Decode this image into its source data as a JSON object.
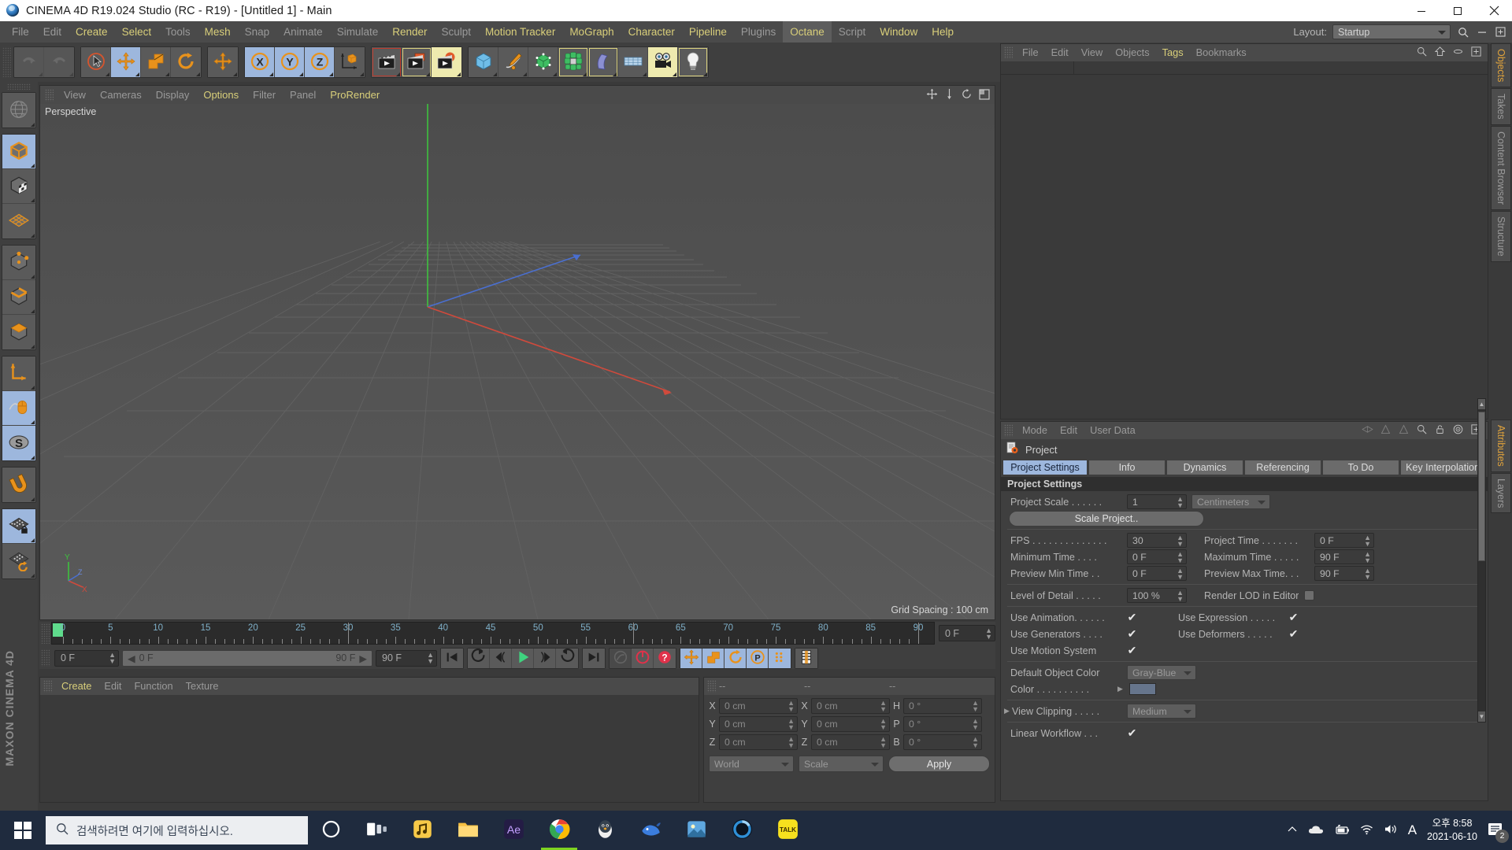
{
  "window": {
    "title": "CINEMA 4D R19.024 Studio (RC - R19) - [Untitled 1] - Main",
    "icon": "c4d-logo-icon",
    "minimize": "─",
    "maximize": "☐",
    "close": "✕"
  },
  "menubar": {
    "items": [
      {
        "label": "File",
        "state": "dim"
      },
      {
        "label": "Edit",
        "state": "dim"
      },
      {
        "label": "Create",
        "state": "hl"
      },
      {
        "label": "Select",
        "state": "hl"
      },
      {
        "label": "Tools",
        "state": "dim"
      },
      {
        "label": "Mesh",
        "state": "hl"
      },
      {
        "label": "Snap",
        "state": "dim"
      },
      {
        "label": "Animate",
        "state": "dim"
      },
      {
        "label": "Simulate",
        "state": "dim"
      },
      {
        "label": "Render",
        "state": "hl"
      },
      {
        "label": "Sculpt",
        "state": "dim"
      },
      {
        "label": "Motion Tracker",
        "state": "hl"
      },
      {
        "label": "MoGraph",
        "state": "hl"
      },
      {
        "label": "Character",
        "state": "hl"
      },
      {
        "label": "Pipeline",
        "state": "hl"
      },
      {
        "label": "Plugins",
        "state": "dim"
      },
      {
        "label": "Octane",
        "state": "boxed"
      },
      {
        "label": "Script",
        "state": "dim"
      },
      {
        "label": "Window",
        "state": "hl"
      },
      {
        "label": "Help",
        "state": "hl"
      }
    ],
    "layout_label": "Layout:",
    "layout_value": "Startup",
    "search_icon": "search-icon",
    "minus_icon": "minus-icon",
    "expand_icon": "expand-icon"
  },
  "toolbar": {
    "groups": [
      {
        "name": "history",
        "buttons": [
          {
            "name": "undo-button",
            "icon": "undo-icon",
            "state": "disabled"
          },
          {
            "name": "redo-button",
            "icon": "redo-icon",
            "state": "disabled"
          }
        ]
      },
      {
        "name": "tools",
        "buttons": [
          {
            "name": "live-selection-button",
            "icon": "cursor-select-icon",
            "state": "normal"
          },
          {
            "name": "move-button",
            "icon": "move-icon",
            "state": "selected"
          },
          {
            "name": "scale-button",
            "icon": "scale-icon",
            "state": "normal"
          },
          {
            "name": "rotate-button",
            "icon": "rotate-icon",
            "state": "normal"
          }
        ]
      },
      {
        "name": "move-alt",
        "buttons": [
          {
            "name": "move-alt-button",
            "icon": "move-icon",
            "state": "normal"
          }
        ]
      },
      {
        "name": "axis-lock",
        "buttons": [
          {
            "name": "axis-x-button",
            "icon": "axis-x-icon",
            "state": "selected"
          },
          {
            "name": "axis-y-button",
            "icon": "axis-y-icon",
            "state": "selected"
          },
          {
            "name": "axis-z-button",
            "icon": "axis-z-icon",
            "state": "selected"
          },
          {
            "name": "world-object-coord-button",
            "icon": "world-coord-icon",
            "state": "normal"
          }
        ]
      },
      {
        "name": "render",
        "buttons": [
          {
            "name": "render-view-button",
            "icon": "clapper-icon",
            "state": "redbox"
          },
          {
            "name": "render-to-picture-viewer-button",
            "icon": "clapper-picture-icon",
            "state": "yellowbox"
          },
          {
            "name": "render-settings-button",
            "icon": "clapper-gear-icon",
            "state": "selected2"
          }
        ]
      },
      {
        "name": "objects",
        "buttons": [
          {
            "name": "add-cube-button",
            "icon": "cube-icon",
            "state": "normal"
          },
          {
            "name": "add-spline-button",
            "icon": "pen-spline-icon",
            "state": "normal"
          },
          {
            "name": "add-generator-button",
            "icon": "green-cube-icon",
            "state": "normal"
          },
          {
            "name": "add-mograph-button",
            "icon": "cloner-icon",
            "state": "yellowbox"
          },
          {
            "name": "add-deformer-button",
            "icon": "bend-deformer-icon",
            "state": "yellowbox"
          },
          {
            "name": "add-environment-button",
            "icon": "floor-icon",
            "state": "normal"
          },
          {
            "name": "add-camera-button",
            "icon": "camera-icon",
            "state": "selected2"
          },
          {
            "name": "add-light-button",
            "icon": "light-bulb-icon",
            "state": "yellowbox"
          }
        ]
      }
    ]
  },
  "left_toolbar": {
    "buttons": [
      {
        "name": "make-editable-button",
        "icon": "globe-wire-icon",
        "state": "normal"
      },
      {
        "name": "model-mode-button",
        "icon": "model-cube-icon",
        "state": "selected"
      },
      {
        "name": "texture-mode-button",
        "icon": "texture-cube-icon",
        "state": "normal"
      },
      {
        "name": "workplane-mode-button",
        "icon": "workplane-grid-icon",
        "state": "normal"
      },
      {
        "name": "points-mode-button",
        "icon": "points-cube-icon",
        "state": "normal"
      },
      {
        "name": "edges-mode-button",
        "icon": "edges-cube-icon",
        "state": "normal"
      },
      {
        "name": "polygons-mode-button",
        "icon": "polygons-cube-icon",
        "state": "normal"
      },
      {
        "name": "object-axis-button",
        "icon": "axis-L-icon",
        "state": "normal"
      },
      {
        "name": "enable-snap-button",
        "icon": "mouse-snap-icon",
        "state": "selected"
      },
      {
        "name": "soft-selection-button",
        "icon": "s-oval-icon",
        "state": "selected"
      },
      {
        "name": "magnet-button",
        "icon": "magnet-icon",
        "state": "normal"
      },
      {
        "name": "lock-workplane-button",
        "icon": "grid-lock-icon",
        "state": "selected"
      },
      {
        "name": "planar-workplane-button",
        "icon": "grid-rotate-icon",
        "state": "normal"
      }
    ],
    "brand_line1": "MAXON",
    "brand_line2": "CINEMA 4D"
  },
  "viewport": {
    "menu": [
      {
        "label": "View",
        "state": "dim"
      },
      {
        "label": "Cameras",
        "state": "dim"
      },
      {
        "label": "Display",
        "state": "dim"
      },
      {
        "label": "Options",
        "state": "hl"
      },
      {
        "label": "Filter",
        "state": "dim"
      },
      {
        "label": "Panel",
        "state": "dim"
      },
      {
        "label": "ProRender",
        "state": "hl"
      }
    ],
    "perspective_label": "Perspective",
    "grid_spacing": "Grid Spacing : 100 cm",
    "axis_labels": {
      "y": "Y",
      "x": "X",
      "z": "Z"
    },
    "nav_icons": [
      "pan-icon",
      "dolly-icon",
      "rotate-view-icon",
      "maximize-view-icon"
    ]
  },
  "timeline": {
    "ticks": [
      0,
      5,
      10,
      15,
      20,
      25,
      30,
      35,
      40,
      45,
      50,
      55,
      60,
      65,
      70,
      75,
      80,
      85,
      90
    ],
    "current_frame_field": "0 F",
    "range_start": "0 F",
    "range_end": "90 F",
    "max_frame_field": "90 F",
    "right_frame_field": "0 F",
    "transport": [
      {
        "name": "go-to-start-button",
        "icon": "skip-start-icon"
      },
      {
        "name": "previous-keyframe-button",
        "icon": "prev-key-icon"
      },
      {
        "name": "step-back-button",
        "icon": "step-back-icon"
      },
      {
        "name": "play-button",
        "icon": "play-icon"
      },
      {
        "name": "step-forward-button",
        "icon": "step-forward-icon"
      },
      {
        "name": "next-keyframe-button",
        "icon": "next-key-icon"
      },
      {
        "name": "go-to-end-button",
        "icon": "skip-end-icon"
      }
    ],
    "record_group": [
      {
        "name": "autokey-button",
        "icon": "autokey-icon",
        "state": "disabled"
      },
      {
        "name": "record-active-objects-button",
        "icon": "record-icon",
        "state": "normal"
      },
      {
        "name": "keyframe-selection-button",
        "icon": "question-key-icon",
        "state": "normal"
      }
    ],
    "key_group": [
      {
        "name": "record-position-button",
        "icon": "move-key-icon",
        "state": "selected"
      },
      {
        "name": "record-scale-button",
        "icon": "scale-key-icon",
        "state": "selected"
      },
      {
        "name": "record-rotation-button",
        "icon": "rotate-key-icon",
        "state": "selected"
      },
      {
        "name": "record-pla-button",
        "icon": "pla-key-icon",
        "state": "selected"
      },
      {
        "name": "record-param-button",
        "icon": "param-key-icon",
        "state": "selected"
      }
    ],
    "timeline_toggle": {
      "name": "timeline-mode-button",
      "icon": "timeline-icon"
    }
  },
  "material_manager": {
    "menu": [
      {
        "label": "Create",
        "state": "hl"
      },
      {
        "label": "Edit",
        "state": "dim"
      },
      {
        "label": "Function",
        "state": "dim"
      },
      {
        "label": "Texture",
        "state": "dim"
      }
    ]
  },
  "coordinate_manager": {
    "headers": [
      "--",
      "--",
      "--"
    ],
    "rows": [
      {
        "pos_label": "X",
        "pos_value": "0 cm",
        "size_label": "X",
        "size_value": "0 cm",
        "rot_label": "H",
        "rot_value": "0 °"
      },
      {
        "pos_label": "Y",
        "pos_value": "0 cm",
        "size_label": "Y",
        "size_value": "0 cm",
        "rot_label": "P",
        "rot_value": "0 °"
      },
      {
        "pos_label": "Z",
        "pos_value": "0 cm",
        "size_label": "Z",
        "size_value": "0 cm",
        "rot_label": "B",
        "rot_value": "0 °"
      }
    ],
    "coord_system": "World",
    "transform_mode": "Scale",
    "apply_label": "Apply"
  },
  "object_manager": {
    "menu": [
      {
        "label": "File",
        "state": "dim"
      },
      {
        "label": "Edit",
        "state": "dim"
      },
      {
        "label": "View",
        "state": "dim"
      },
      {
        "label": "Objects",
        "state": "dim"
      },
      {
        "label": "Tags",
        "state": "hl"
      },
      {
        "label": "Bookmarks",
        "state": "dim"
      }
    ],
    "icons": [
      "search-icon",
      "home-icon",
      "ellipse-icon",
      "expand-icon"
    ]
  },
  "attribute_manager": {
    "menu": [
      {
        "label": "Mode",
        "state": "dim"
      },
      {
        "label": "Edit",
        "state": "dim"
      },
      {
        "label": "User Data",
        "state": "dim"
      }
    ],
    "icons": [
      "history-back-icon",
      "history-forward-icon",
      "up-level-icon",
      "search-icon",
      "lock-icon",
      "target-icon",
      "expand-icon"
    ],
    "object_name": "Project",
    "object_icon": "project-settings-icon",
    "tabs": [
      {
        "label": "Project Settings",
        "active": true
      },
      {
        "label": "Info",
        "active": false
      },
      {
        "label": "Dynamics",
        "active": false
      },
      {
        "label": "Referencing",
        "active": false
      },
      {
        "label": "To Do",
        "active": false
      },
      {
        "label": "Key Interpolation",
        "active": false
      }
    ],
    "section_title": "Project Settings",
    "fields": {
      "project_scale_label": "Project Scale . . . . . .",
      "project_scale_value": "1",
      "project_scale_unit": "Centimeters",
      "scale_project_button": "Scale Project..",
      "fps_label": "FPS . . . . . . . . . . . . . .",
      "fps_value": "30",
      "project_time_label": "Project Time . . . . . . .",
      "project_time_value": "0 F",
      "minimum_time_label": "Minimum Time . . . .",
      "minimum_time_value": "0 F",
      "maximum_time_label": "Maximum Time . . . . .",
      "maximum_time_value": "90 F",
      "preview_min_label": "Preview Min Time . .",
      "preview_min_value": "0 F",
      "preview_max_label": "Preview Max Time. . .",
      "preview_max_value": "90 F",
      "lod_label": "Level of Detail . . . . .",
      "lod_value": "100 %",
      "render_lod_label": "Render LOD in Editor",
      "use_animation_label": "Use Animation. . . . . .",
      "use_expression_label": "Use Expression . . . . .",
      "use_generators_label": "Use Generators . . . .",
      "use_deformers_label": "Use Deformers . . . . .",
      "use_motion_label": "Use Motion System",
      "default_object_color_label": "Default Object Color",
      "default_object_color_value": "Gray-Blue",
      "color_label": "Color . . . . . . . . . .",
      "color_swatch": "#66758c",
      "view_clipping_label": "View Clipping . . . . .",
      "view_clipping_value": "Medium",
      "linear_workflow_label": "Linear Workflow . . .",
      "check_glyph": "✔"
    }
  },
  "right_tabs": {
    "upper": [
      {
        "label": "Objects",
        "active": true
      },
      {
        "label": "Takes",
        "active": false
      },
      {
        "label": "Content Browser",
        "active": false
      },
      {
        "label": "Structure",
        "active": false
      }
    ],
    "lower": [
      {
        "label": "Attributes",
        "active": true
      },
      {
        "label": "Layers",
        "active": false
      }
    ]
  },
  "taskbar": {
    "start_icon": "windows-start-icon",
    "search_icon": "search-icon",
    "search_placeholder": "검색하려면 여기에 입력하십시오.",
    "apps": [
      {
        "name": "cortana-icon",
        "label": "Cortana"
      },
      {
        "name": "task-view-icon",
        "label": "Task View"
      },
      {
        "name": "kakao-music-icon",
        "label": "App"
      },
      {
        "name": "file-explorer-icon",
        "label": "File Explorer"
      },
      {
        "name": "after-effects-icon",
        "label": "Ae"
      },
      {
        "name": "chrome-icon",
        "label": "Chrome"
      },
      {
        "name": "penguin-app-icon",
        "label": "App"
      },
      {
        "name": "blue-whale-icon",
        "label": "Whale"
      },
      {
        "name": "photos-icon",
        "label": "App"
      },
      {
        "name": "cinema4d-icon",
        "label": "Cinema 4D"
      },
      {
        "name": "kakaotalk-icon",
        "label": "TALK"
      }
    ],
    "tray": {
      "show_hidden_icon": "chevron-up-icon",
      "onedrive_icon": "cloud-icon",
      "battery_icon": "battery-icon",
      "wifi_icon": "wifi-icon",
      "volume_icon": "speaker-icon",
      "ime_icon": "A",
      "time": "오후 8:58",
      "date": "2021-06-10",
      "notification_count": "2"
    }
  },
  "colors": {
    "accent_selected": "#9db7dd",
    "accent_yellow": "#eeeaae",
    "menu_highlight": "#d9cf7a",
    "panel_bg": "#3f3f3f",
    "viewport_bg": "#535353",
    "taskbar_bg": "#1f2b3e",
    "axis_x": "#d04a3c",
    "axis_y": "#4ec24e",
    "axis_z": "#4a6fd0"
  }
}
